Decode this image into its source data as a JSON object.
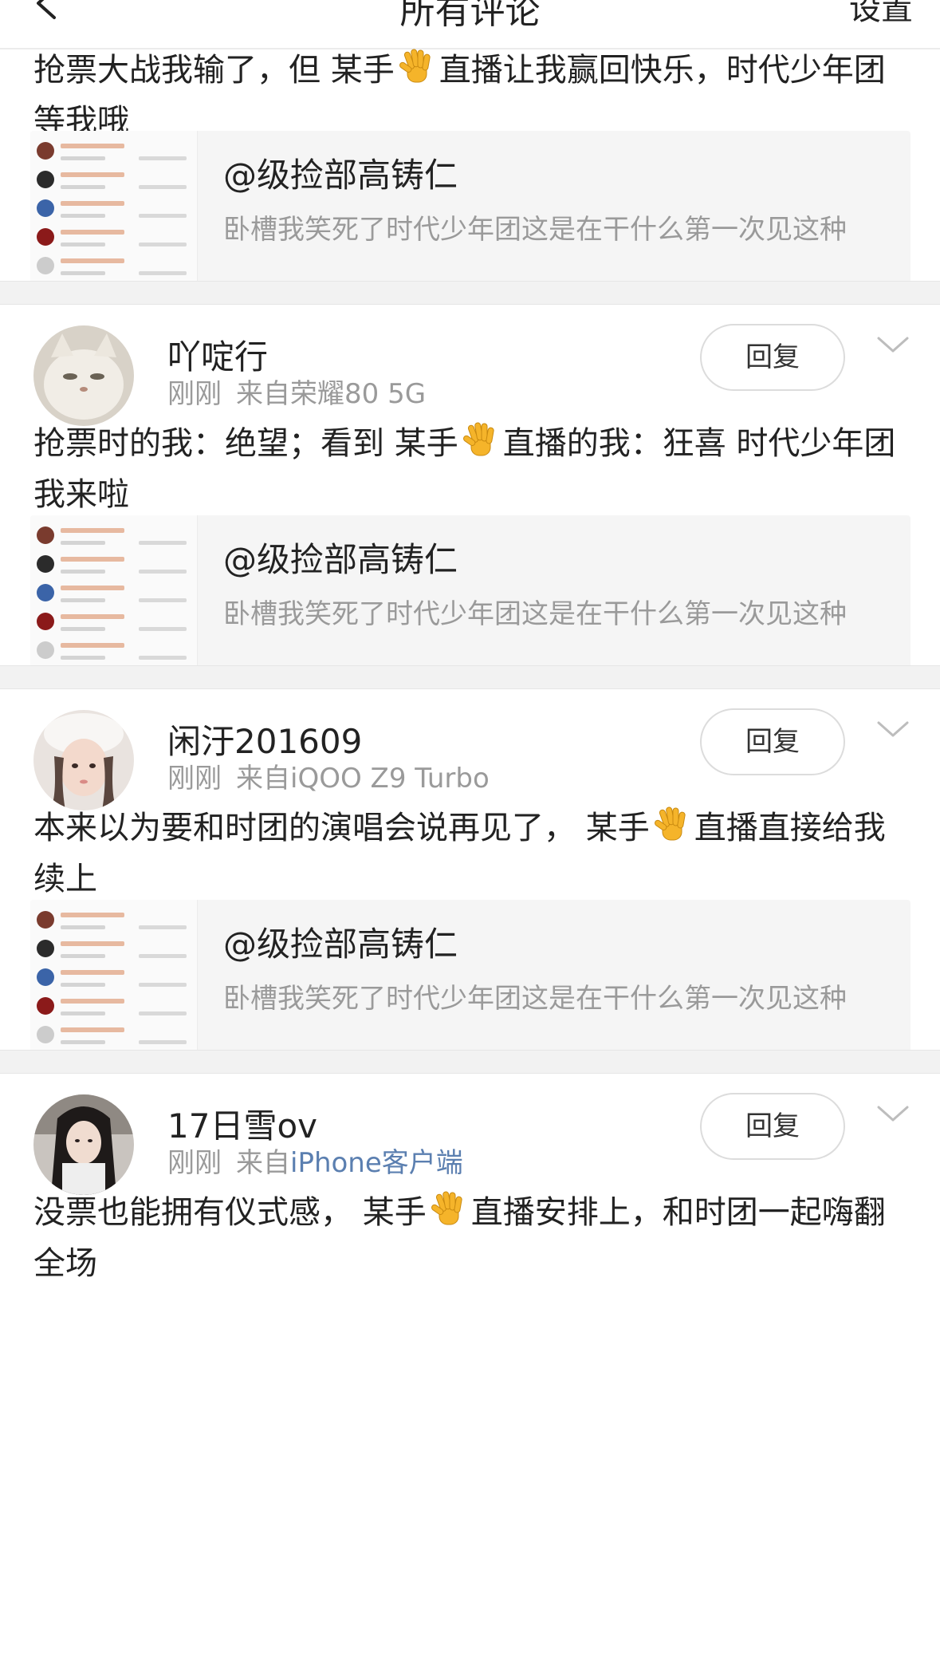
{
  "header": {
    "title": "所有评论",
    "settings_label": "设置"
  },
  "first_comment": {
    "text_before": "抢票大战我输了，但 某手",
    "text_after": "直播让我赢回快乐，时代少年团等我哦"
  },
  "quote": {
    "user": "@级捡部高铸仁",
    "text": "卧槽我笑死了时代少年团这是在干什么第一次见这种"
  },
  "comments": [
    {
      "username": "吖啶行",
      "time": "刚刚",
      "source": "来自荣耀80 5G",
      "text_before": "抢票时的我：绝望；看到 某手",
      "text_after": "直播的我：狂喜 时代少年团我来啦",
      "reply_label": "回复"
    },
    {
      "username": "闲汙201609",
      "time": "刚刚",
      "source": "来自iQOO Z9 Turbo",
      "text_before": "本来以为要和时团的演唱会说再见了， 某手",
      "text_after": "直播直接给我续上",
      "reply_label": "回复"
    },
    {
      "username": "17日雪ov",
      "time": "刚刚",
      "source_prefix": "来自",
      "source": "iPhone客户端",
      "text_before": "没票也能拥有仪式感， 某手",
      "text_after": "直播安排上，和时团一起嗨翻全场",
      "reply_label": "回复"
    }
  ],
  "icons": {
    "back": "back-arrow-icon",
    "wave": "waving-hand-emoji-icon",
    "more": "chevron-down-icon"
  },
  "colors": {
    "link": "#5b7fb0",
    "muted": "#9a9a9a",
    "separator": "#f2f2f2"
  }
}
